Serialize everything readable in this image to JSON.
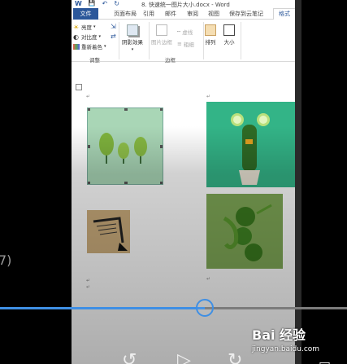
{
  "side_text": "7)",
  "titlebar": {
    "title": "8. 快速统一图片大小.docx - Word",
    "quick_access": [
      "W",
      "💾",
      "↶",
      "↻"
    ]
  },
  "tabs": {
    "file": "文件",
    "items": [
      "页面布局",
      "引用",
      "邮件",
      "审阅",
      "视图",
      "保存到云笔记"
    ],
    "active": "格式"
  },
  "ribbon": {
    "adjust": {
      "brightness": "亮度",
      "contrast": "对比度",
      "recolor": "重新着色",
      "label": "调整"
    },
    "shadow_effects": "阴影效果",
    "border": {
      "picture_border": "图片边框",
      "dashes": "虚线",
      "weight": "粗细",
      "label": "边框"
    },
    "arrange": "排列",
    "size": "大小"
  },
  "video": {
    "progress_percent": 59
  },
  "watermark": {
    "brand": "Bai 经验",
    "url": "jingyan.baidu.com"
  },
  "colors": {
    "accent": "#2b579a",
    "progress": "#3f8fe4"
  }
}
